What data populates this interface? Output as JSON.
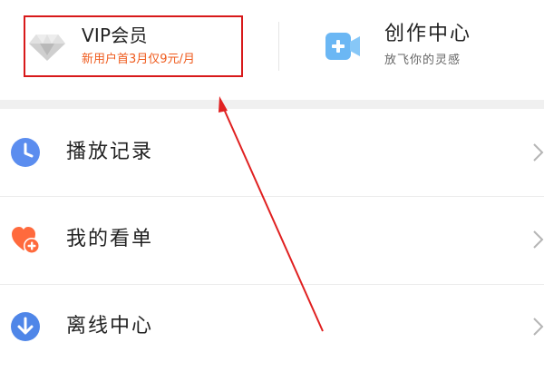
{
  "vip": {
    "title": "VIP会员",
    "subtitle": "新用户首3月仅9元/月",
    "icon": "vip-diamond-icon"
  },
  "creator": {
    "title": "创作中心",
    "subtitle": "放飞你的灵感",
    "icon": "video-camera-plus-icon"
  },
  "menu": {
    "items": [
      {
        "label": "播放记录",
        "icon": "clock-icon"
      },
      {
        "label": "我的看单",
        "icon": "heart-plus-icon"
      },
      {
        "label": "离线中心",
        "icon": "download-arrow-icon"
      }
    ]
  },
  "colors": {
    "highlight_border": "#d8191a",
    "annotation_arrow": "#e02020",
    "vip_accent": "#ef5a1c",
    "clock_icon": "#5b8def",
    "heart_icon": "#ff6a3d",
    "download_icon": "#4f86e8",
    "camera_icon": "#6bb7f4"
  }
}
